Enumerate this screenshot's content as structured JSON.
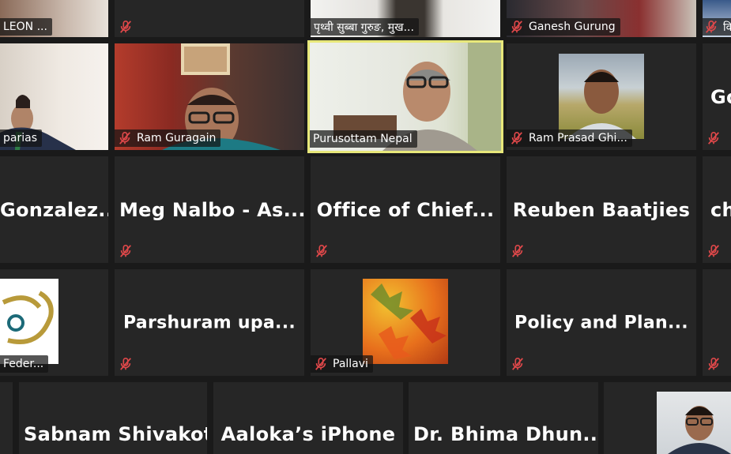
{
  "window": {
    "app": "Video meeting gallery view"
  },
  "row0": {
    "t1": {
      "name": "LEON ..."
    },
    "t2": {
      "name": ""
    },
    "t3": {
      "name": "पृथ्वी सुब्बा गुरुङ, मुख..."
    },
    "t4": {
      "name": "Ganesh Gurung"
    },
    "t5": {
      "name": "कि"
    }
  },
  "row1": {
    "t1": {
      "name": "parias"
    },
    "t2": {
      "name": "Ram Guragain"
    },
    "t3": {
      "name": "Purusottam Nepal"
    },
    "t4": {
      "name": "Ram Prasad Ghi..."
    },
    "t5": {
      "name": "Go"
    }
  },
  "row2": {
    "t1": {
      "name": "Gonzalez..."
    },
    "t2": {
      "name": "Meg Nalbo - As..."
    },
    "t3": {
      "name": "Office of Chief..."
    },
    "t4": {
      "name": "Reuben Baatjies"
    },
    "t5": {
      "name": "ch"
    }
  },
  "row3": {
    "t1": {
      "name": "Feder..."
    },
    "t2": {
      "name": "Parshuram upa..."
    },
    "t3": {
      "name": "Pallavi"
    },
    "t4": {
      "name": "Policy and Plan..."
    }
  },
  "row4": {
    "t1": {
      "name": "Sabnam Shivakoti"
    },
    "t2": {
      "name": "Aaloka’s iPhone"
    },
    "t3": {
      "name": "Dr. Bhima Dhun..."
    }
  },
  "icons": {
    "muted": "muted-mic-icon"
  },
  "colors": {
    "active_border": "#e8e87a",
    "muted_icon": "#e0484a",
    "tile_bg": "#262626"
  }
}
